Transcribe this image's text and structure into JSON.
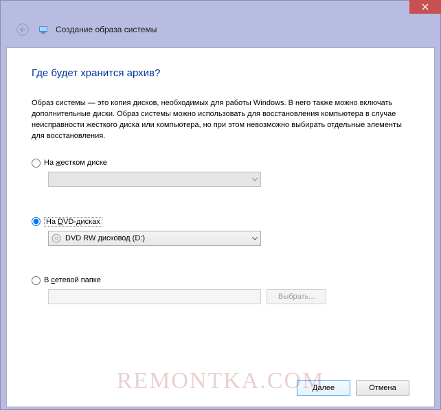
{
  "window": {
    "title": "Создание образа системы"
  },
  "page": {
    "heading": "Где будет хранится архив?",
    "description": "Образ системы — это копия дисков, необходимых для работы Windows. В него также можно включать дополнительные диски. Образ системы можно использовать для восстановления компьютера в случае неисправности жесткого диска или компьютера, но при этом невозможно выбирать отдельные элементы для восстановления."
  },
  "options": {
    "hdd": {
      "label_pre": "На ",
      "label_u": "ж",
      "label_post": "естком диске",
      "selected_value": ""
    },
    "dvd": {
      "label_pre": "На ",
      "label_u": "D",
      "label_post": "VD-дисках",
      "selected_value": "DVD RW дисковод (D:)"
    },
    "network": {
      "label_pre": "В ",
      "label_u": "с",
      "label_post": "етевой папке",
      "value": "",
      "browse_label": "Выбрать..."
    }
  },
  "footer": {
    "next": "Далее",
    "cancel": "Отмена"
  },
  "watermark": "REMONTKA.COM"
}
